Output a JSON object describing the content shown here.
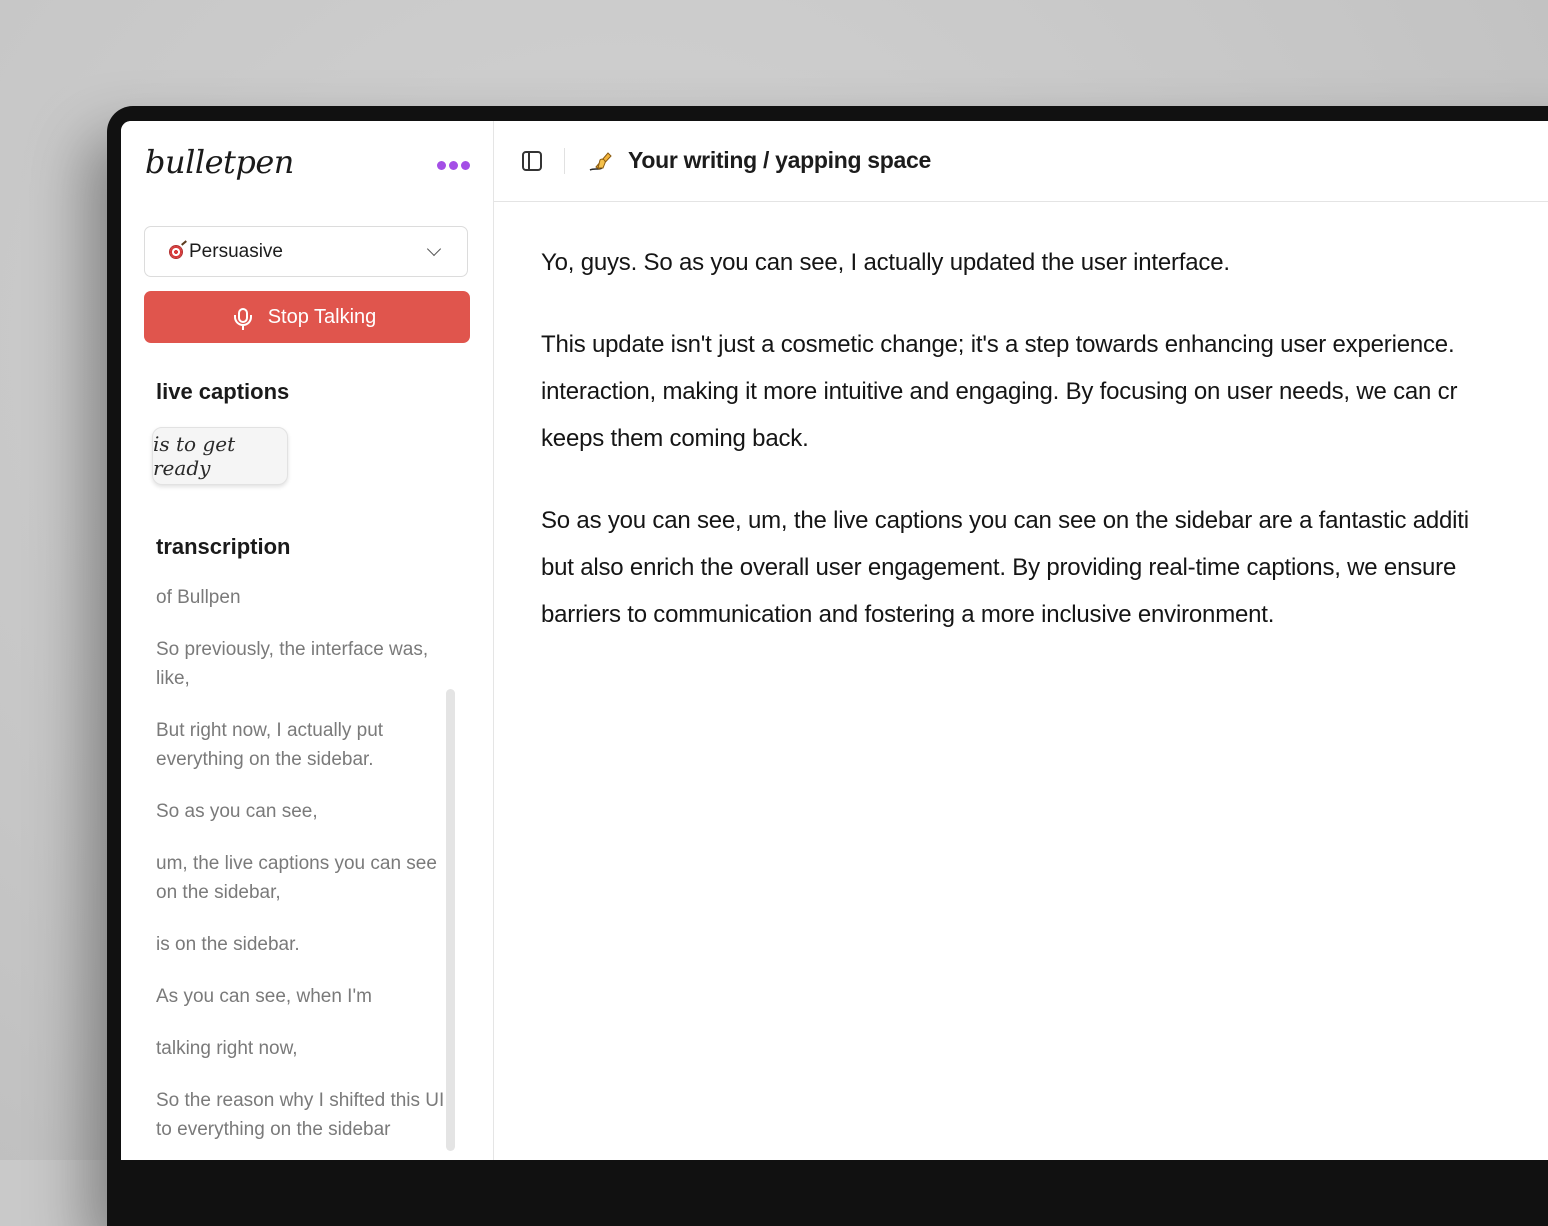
{
  "app": {
    "logo": "bulletpen"
  },
  "sidebar": {
    "mode_select": {
      "icon": "target-icon",
      "value": "Persuasive"
    },
    "stop_button_label": "Stop Talking",
    "live_captions_title": "live captions",
    "live_caption_text": "is to get ready",
    "transcription_title": "transcription",
    "transcription_items": [
      "of Bullpen",
      "So previously, the interface was, like,",
      "But right now, I actually put everything on the sidebar.",
      "So as you can see,",
      "um, the live captions you can see on the sidebar,",
      "is on the sidebar.",
      "As you can see, when I'm",
      "talking right now,",
      "So the reason why I shifted this UI to everything on the sidebar"
    ]
  },
  "header": {
    "title_emoji": "✍️",
    "title": "Your writing / yapping space"
  },
  "editor": {
    "paragraphs": [
      [
        "Yo, guys. So as you can see, I actually updated the user interface."
      ],
      [
        "This update isn't just a cosmetic change; it's a step towards enhancing user experience.",
        "interaction, making it more intuitive and engaging. By focusing on user needs, we can cr",
        "keeps them coming back."
      ],
      [
        "So as you can see, um, the live captions you can see on the sidebar are a fantastic additi",
        "but also enrich the overall user engagement. By providing real-time captions, we ensure",
        "barriers to communication and fostering a more inclusive environment."
      ]
    ]
  },
  "colors": {
    "accent_purple": "#a44fe6",
    "stop_red": "#e0554d"
  }
}
